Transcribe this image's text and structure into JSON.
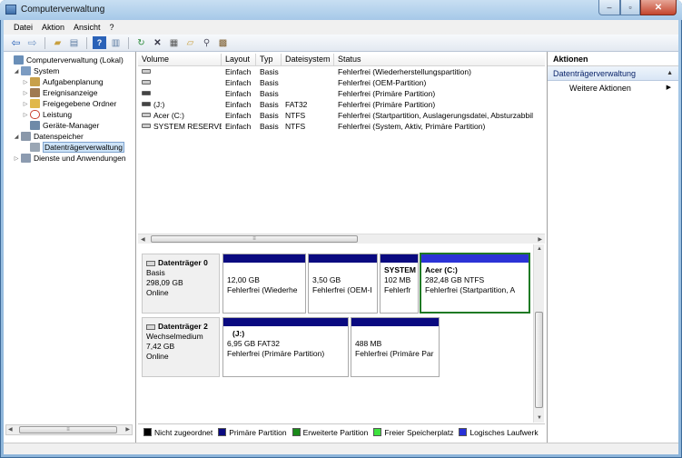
{
  "window": {
    "title": "Computerverwaltung"
  },
  "menu": [
    "Datei",
    "Aktion",
    "Ansicht",
    "?"
  ],
  "tree": [
    {
      "label": "Computerverwaltung (Lokal)",
      "level": 0,
      "twisty": "",
      "icon_color": "#6a8fb8"
    },
    {
      "label": "System",
      "level": 1,
      "twisty": "◢",
      "icon_color": "#7c9cc2"
    },
    {
      "label": "Aufgabenplanung",
      "level": 2,
      "twisty": "▷",
      "icon_color": "#c8a04a"
    },
    {
      "label": "Ereignisanzeige",
      "level": 2,
      "twisty": "▷",
      "icon_color": "#a07a52"
    },
    {
      "label": "Freigegebene Ordner",
      "level": 2,
      "twisty": "▷",
      "icon_color": "#e0b84a"
    },
    {
      "label": "Leistung",
      "level": 2,
      "twisty": "▷",
      "icon_color": "#c8402e"
    },
    {
      "label": "Geräte-Manager",
      "level": 2,
      "twisty": "",
      "icon_color": "#6f8aa8"
    },
    {
      "label": "Datenspeicher",
      "level": 1,
      "twisty": "◢",
      "icon_color": "#8a98aa"
    },
    {
      "label": "Datenträgerverwaltung",
      "level": 2,
      "twisty": "",
      "icon_color": "#9aa6b4"
    },
    {
      "label": "Dienste und Anwendungen",
      "level": 1,
      "twisty": "▷",
      "icon_color": "#8c9bb0"
    }
  ],
  "volumes": {
    "headers": [
      "Volume",
      "Layout",
      "Typ",
      "Dateisystem",
      "Status"
    ],
    "rows": [
      [
        "",
        "Einfach",
        "Basis",
        "",
        "Fehlerfrei (Wiederherstellungspartition)"
      ],
      [
        "",
        "Einfach",
        "Basis",
        "",
        "Fehlerfrei (OEM-Partition)"
      ],
      [
        "",
        "Einfach",
        "Basis",
        "",
        "Fehlerfrei (Primäre Partition)"
      ],
      [
        "(J:)",
        "Einfach",
        "Basis",
        "FAT32",
        "Fehlerfrei (Primäre Partition)"
      ],
      [
        "Acer (C:)",
        "Einfach",
        "Basis",
        "NTFS",
        "Fehlerfrei (Startpartition, Auslagerungsdatei, Absturzabbil"
      ],
      [
        "SYSTEM RESERVED",
        "Einfach",
        "Basis",
        "NTFS",
        "Fehlerfrei (System, Aktiv, Primäre Partition)"
      ]
    ]
  },
  "disks": [
    {
      "name": "Datenträger 0",
      "type": "Basis",
      "size": "298,09 GB",
      "state": "Online",
      "partitions": [
        {
          "title": "",
          "line1": "12,00 GB",
          "line2": "Fehlerfrei (Wiederhe",
          "selected": false
        },
        {
          "title": "",
          "line1": "3,50 GB",
          "line2": "Fehlerfrei (OEM-I",
          "selected": false
        },
        {
          "title": "SYSTEM",
          "line1": "102 MB",
          "line2": "Fehlerfr",
          "selected": false
        },
        {
          "title": "Acer  (C:)",
          "line1": "282,48 GB NTFS",
          "line2": "Fehlerfrei (Startpartition, A",
          "selected": true
        }
      ]
    },
    {
      "name": "Datenträger 2",
      "type": "Wechselmedium",
      "size": "7,42 GB",
      "state": "Online",
      "partitions": [
        {
          "title": "(J:)",
          "line1": "6,95 GB FAT32",
          "line2": "Fehlerfrei (Primäre Partition)",
          "selected": false
        },
        {
          "title": "",
          "line1": "488 MB",
          "line2": "Fehlerfrei (Primäre Par",
          "selected": false
        }
      ]
    }
  ],
  "legend": [
    {
      "label": "Nicht zugeordnet",
      "color": "#000000"
    },
    {
      "label": "Primäre Partition",
      "color": "#0a0a80"
    },
    {
      "label": "Erweiterte Partition",
      "color": "#1a8a1a"
    },
    {
      "label": "Freier Speicherplatz",
      "color": "#3ee23e"
    },
    {
      "label": "Logisches Laufwerk",
      "color": "#2830d8"
    }
  ],
  "actions": {
    "title": "Aktionen",
    "section": "Datenträgerverwaltung",
    "item": "Weitere Aktionen"
  }
}
